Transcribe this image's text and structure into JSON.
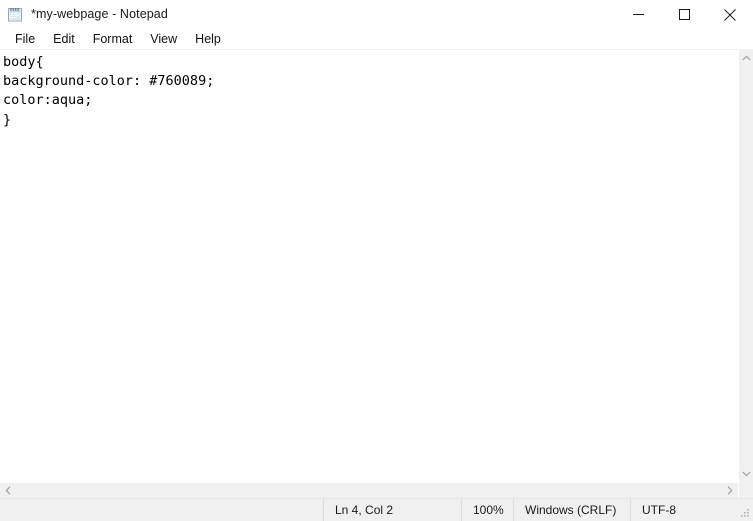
{
  "window": {
    "title": "*my-webpage - Notepad",
    "icon": "notepad-icon",
    "controls": {
      "minimize": "minimize-icon",
      "maximize": "maximize-icon",
      "close": "close-icon"
    }
  },
  "menubar": {
    "items": [
      {
        "label": "File"
      },
      {
        "label": "Edit"
      },
      {
        "label": "Format"
      },
      {
        "label": "View"
      },
      {
        "label": "Help"
      }
    ]
  },
  "editor": {
    "content": "body{\nbackground-color: #760089;\ncolor:aqua;\n}",
    "lines": [
      "body{",
      "background-color: #760089;",
      "color:aqua;",
      "}"
    ]
  },
  "scrollbars": {
    "vertical": {
      "up": "chevron-up-icon",
      "down": "chevron-down-icon"
    },
    "horizontal": {
      "left": "chevron-left-icon",
      "right": "chevron-right-icon"
    }
  },
  "statusbar": {
    "cursor": "Ln 4, Col 2",
    "zoom": "100%",
    "line_ending": "Windows (CRLF)",
    "encoding": "UTF-8",
    "grip": "resize-grip-icon"
  },
  "colors": {
    "title_bar_bg": "#ffffff",
    "menu_bg": "#ffffff",
    "editor_bg": "#ffffff",
    "editor_text": "#000000",
    "status_bg": "#f0f0f0",
    "scrollbar_track": "#f0f0f0",
    "separator": "#dcdcdc",
    "css_value_color": "#760089"
  }
}
